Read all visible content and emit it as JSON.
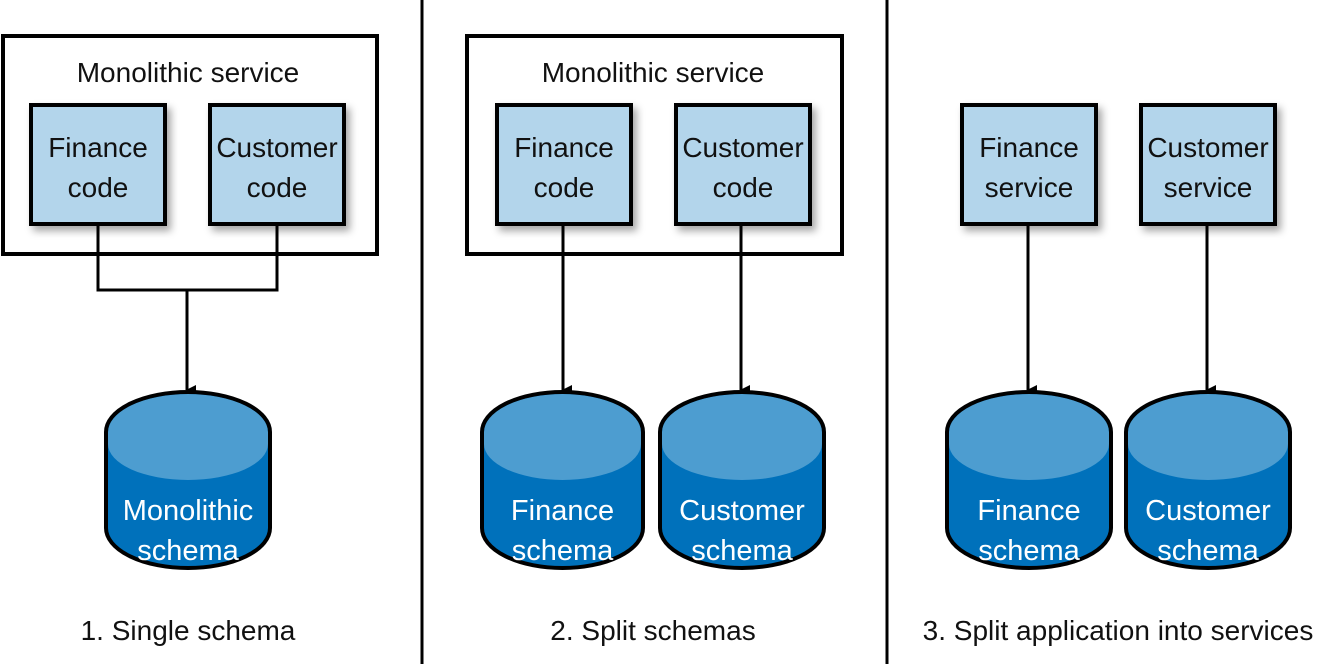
{
  "colors": {
    "code_box": "#b3d5eb",
    "db_top": "#4d9dd0",
    "db_body": "#0071bb",
    "stroke": "#000000"
  },
  "panels": [
    {
      "caption": "1. Single schema",
      "container": "Monolithic service",
      "boxes": [
        {
          "line1": "Finance",
          "line2": "code"
        },
        {
          "line1": "Customer",
          "line2": "code"
        }
      ],
      "databases": [
        {
          "line1": "Monolithic",
          "line2": "schema"
        }
      ]
    },
    {
      "caption": "2. Split schemas",
      "container": "Monolithic service",
      "boxes": [
        {
          "line1": "Finance",
          "line2": "code"
        },
        {
          "line1": "Customer",
          "line2": "code"
        }
      ],
      "databases": [
        {
          "line1": "Finance",
          "line2": "schema"
        },
        {
          "line1": "Customer",
          "line2": "schema"
        }
      ]
    },
    {
      "caption": "3. Split application into services",
      "boxes": [
        {
          "line1": "Finance",
          "line2": "service"
        },
        {
          "line1": "Customer",
          "line2": "service"
        }
      ],
      "databases": [
        {
          "line1": "Finance",
          "line2": "schema"
        },
        {
          "line1": "Customer",
          "line2": "schema"
        }
      ]
    }
  ]
}
